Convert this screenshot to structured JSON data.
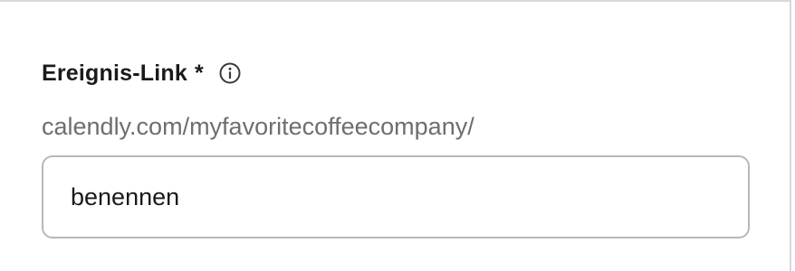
{
  "event_link_field": {
    "label": "Ereignis-Link",
    "required_marker": "*",
    "info_icon": "info-circle-icon",
    "url_prefix": "calendly.com/myfavoritecoffeecompany/",
    "slug_value": "benennen"
  },
  "colors": {
    "label_text": "#1a1a1a",
    "prefix_text": "#6e6e6e",
    "input_border": "#b8b8b8",
    "panel_border": "#d9d9d9"
  }
}
